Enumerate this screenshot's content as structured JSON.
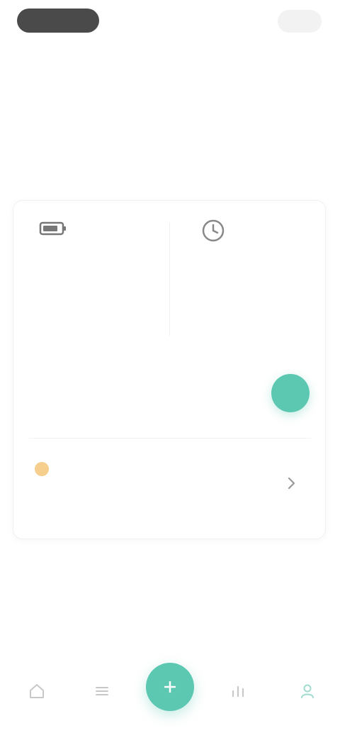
{
  "status": {
    "pill_label": ""
  },
  "header": {
    "top_action_label": "",
    "back_label": ""
  },
  "page": {
    "title": "",
    "description": ""
  },
  "stats": [
    {
      "icon": "battery-icon",
      "value": "",
      "label": ""
    },
    {
      "icon": "clock-icon",
      "value": "",
      "label": ""
    }
  ],
  "rows": [
    {
      "title": "",
      "subtitle": "",
      "control": "toggle"
    },
    {
      "title": "",
      "subtitle": "",
      "control": "chevron-right-icon"
    }
  ],
  "bottom_nav": [
    {
      "icon": "home-icon"
    },
    {
      "icon": "list-icon"
    },
    {
      "icon": "plus-icon"
    },
    {
      "icon": "chart-icon"
    },
    {
      "icon": "user-icon"
    }
  ],
  "colors": {
    "accent": "#5dc8b2",
    "warning": "#f5c57a",
    "text_primary": "#333333",
    "text_secondary": "#999999"
  }
}
